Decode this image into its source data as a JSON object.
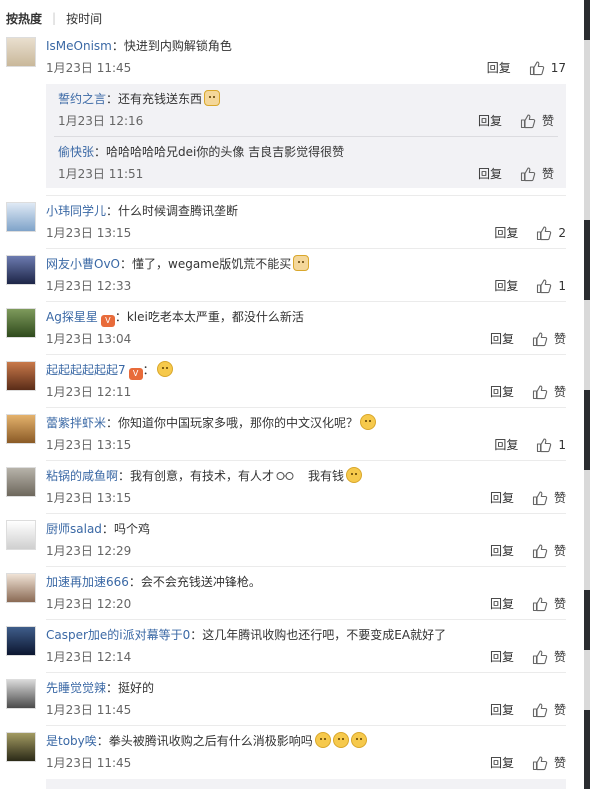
{
  "sort": {
    "hot_label": "按热度",
    "time_label": "按时间"
  },
  "reply_label": "回复",
  "like_icon_name": "thumbs-up-icon",
  "comments": [
    {
      "user": "IsMeOnism",
      "text": "快进到内购解锁角色",
      "time": "1月23日 11:45",
      "likes": "17"
    },
    {
      "user": "小玮同学儿",
      "text": "什么时候调查腾讯垄断",
      "time": "1月23日 13:15",
      "likes": "2"
    },
    {
      "user": "网友小曹OvO",
      "text": "懂了，wegame版饥荒不能买",
      "time": "1月23日 12:33",
      "likes": "1"
    },
    {
      "user": "Ag探星星",
      "text": "klei吃老本太严重，都没什么新活",
      "time": "1月23日 13:04",
      "likes": "赞"
    },
    {
      "user": "起起起起起起7",
      "text": "",
      "time": "1月23日 12:11",
      "likes": "赞"
    },
    {
      "user": "蕾紫拌虾米",
      "text": "你知道你中国玩家多哦，那你的中文汉化呢？",
      "time": "1月23日 13:15",
      "likes": "1"
    },
    {
      "user": "粘锅的咸鱼啊",
      "text": "我有创意，有技术，有人才",
      "text2": "我有钱",
      "time": "1月23日 13:15",
      "likes": "赞"
    },
    {
      "user": "厨师salad",
      "text": "吗个鸡",
      "time": "1月23日 12:29",
      "likes": "赞"
    },
    {
      "user": "加速再加速666",
      "text": "会不会充钱送冲锋枪。",
      "time": "1月23日 12:20",
      "likes": "赞"
    },
    {
      "user": "Casper加e的i派对幕等于0",
      "text": "这几年腾讯收购也还行吧，不要变成EA就好了",
      "time": "1月23日 12:14",
      "likes": "赞"
    },
    {
      "user": "先睡觉觉辣",
      "text": "挺好的",
      "time": "1月23日 11:45",
      "likes": "赞"
    },
    {
      "user": "是toby唉",
      "text": "拳头被腾讯收购之后有什么消极影响吗",
      "time": "1月23日 11:45",
      "likes": "赞"
    }
  ],
  "sub_replies": [
    {
      "user": "誓约之言",
      "text": "还有充钱送东西",
      "time": "1月23日 12:16",
      "likes": "赞"
    },
    {
      "user": "偷快张",
      "text": "哈哈哈哈哈兄dei你的头像 吉良吉影觉得很赞",
      "time": "1月23日 11:51",
      "likes": "赞"
    }
  ]
}
